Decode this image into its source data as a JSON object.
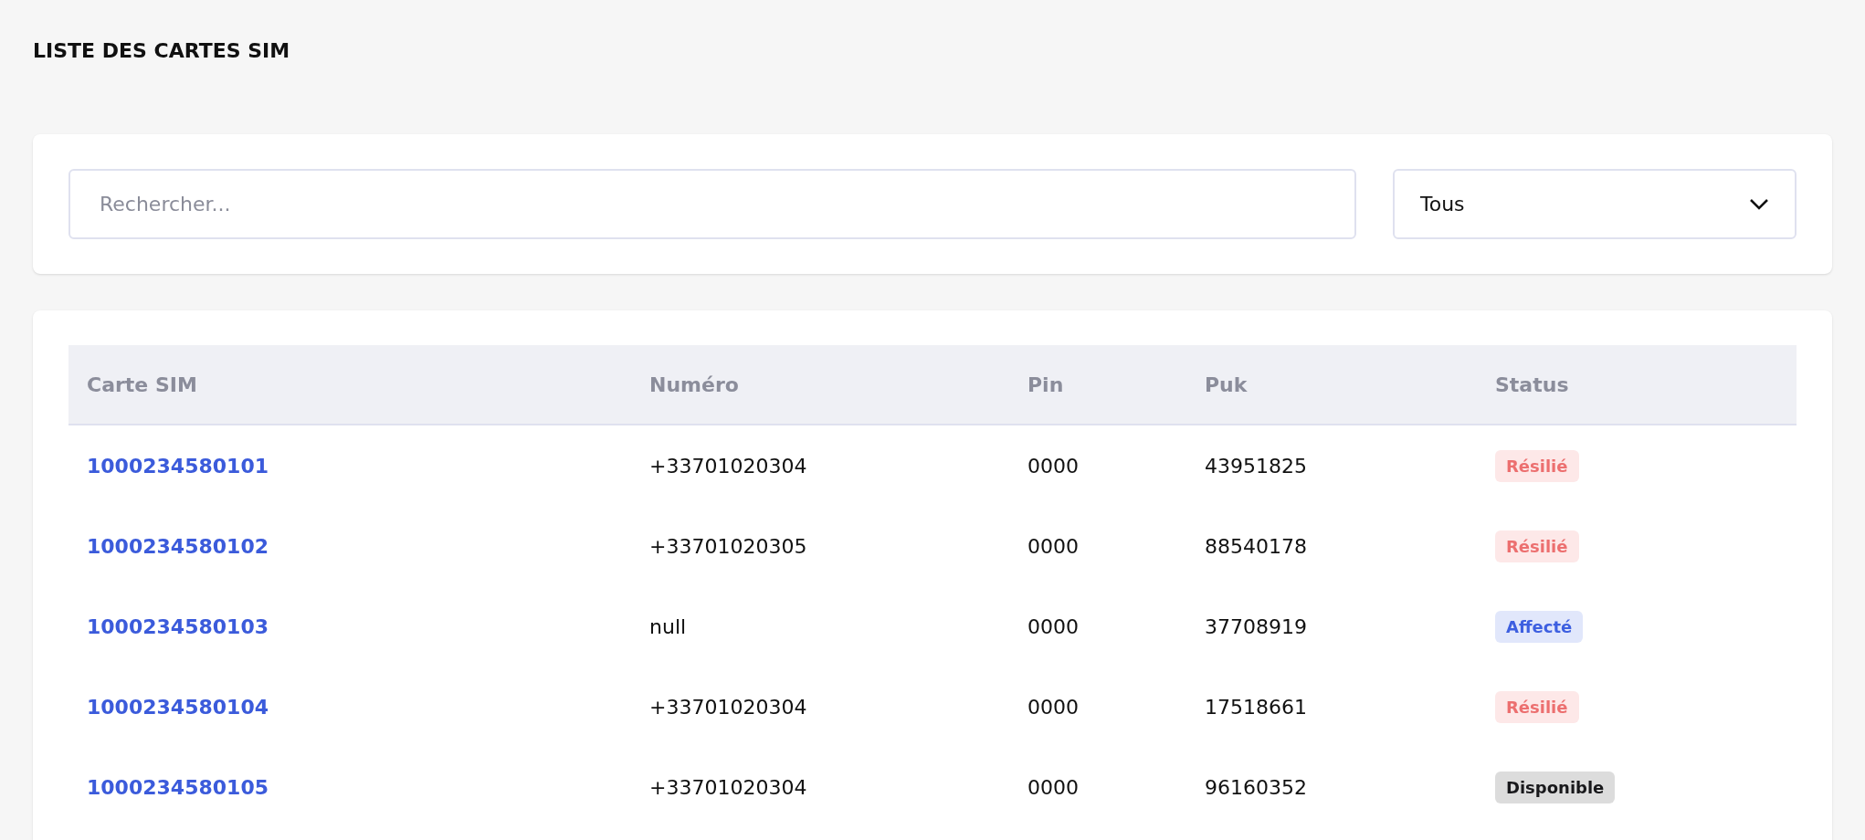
{
  "page_title": "LISTE DES CARTES SIM",
  "filters": {
    "search": {
      "placeholder": "Rechercher..."
    },
    "status_select": {
      "value": "Tous"
    }
  },
  "table": {
    "columns": [
      "Carte SIM",
      "Numéro",
      "Pin",
      "Puk",
      "Status"
    ],
    "rows": [
      {
        "sim": "1000234580101",
        "numero": "+33701020304",
        "pin": "0000",
        "puk": "43951825",
        "status": {
          "label": "Résilié",
          "kind": "terminated"
        }
      },
      {
        "sim": "1000234580102",
        "numero": "+33701020305",
        "pin": "0000",
        "puk": "88540178",
        "status": {
          "label": "Résilié",
          "kind": "terminated"
        }
      },
      {
        "sim": "1000234580103",
        "numero": "null",
        "pin": "0000",
        "puk": "37708919",
        "status": {
          "label": "Affecté",
          "kind": "assigned"
        }
      },
      {
        "sim": "1000234580104",
        "numero": "+33701020304",
        "pin": "0000",
        "puk": "17518661",
        "status": {
          "label": "Résilié",
          "kind": "terminated"
        }
      },
      {
        "sim": "1000234580105",
        "numero": "+33701020304",
        "pin": "0000",
        "puk": "96160352",
        "status": {
          "label": "Disponible",
          "kind": "available"
        }
      }
    ]
  }
}
